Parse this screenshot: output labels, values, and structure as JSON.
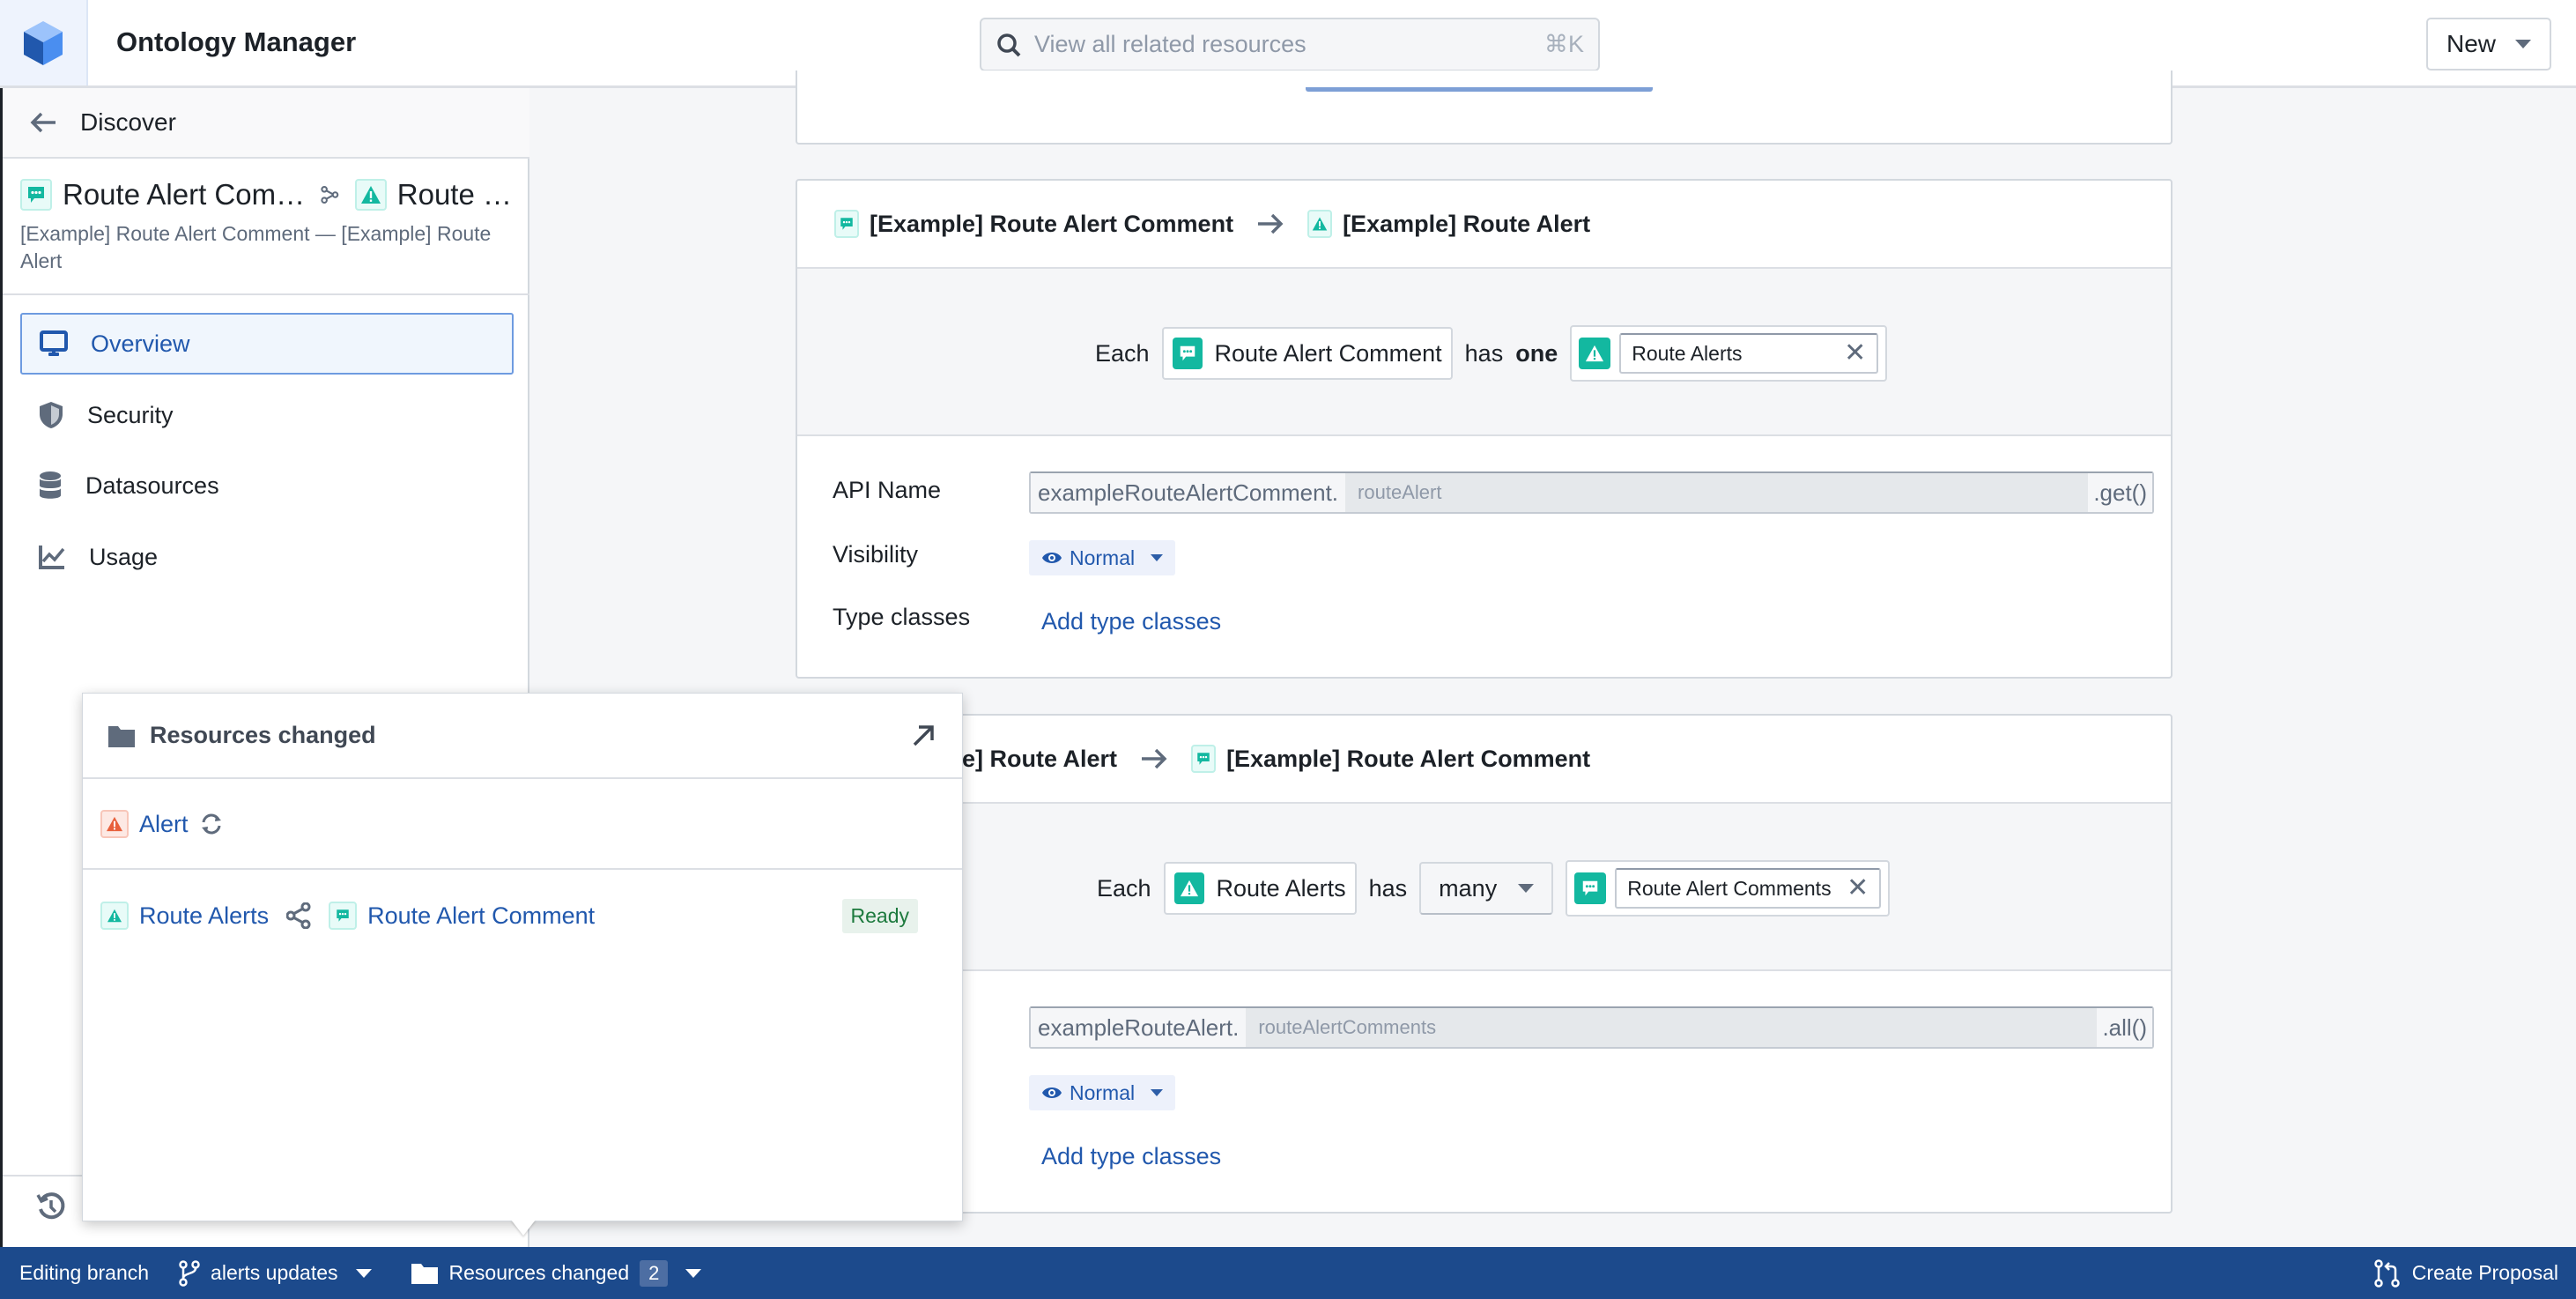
{
  "header": {
    "app_title": "Ontology Manager",
    "search_placeholder": "View all related resources",
    "search_shortcut": "⌘K",
    "new_button": "New"
  },
  "sidebar": {
    "back_label": "Discover",
    "link_title_left": "Route Alert Com…",
    "link_title_right": "Route …",
    "link_subtitle": "[Example] Route Alert Comment — [Example] Route Alert",
    "nav_items": [
      {
        "label": "Overview",
        "icon": "monitor-icon",
        "active": true
      },
      {
        "label": "Security",
        "icon": "shield-icon",
        "active": false
      },
      {
        "label": "Datasources",
        "icon": "database-icon",
        "active": false
      },
      {
        "label": "Usage",
        "icon": "chart-line-icon",
        "active": false
      }
    ],
    "history_icon": "history-icon"
  },
  "cards": [
    {
      "source": "[Example] Route Alert Comment",
      "target": "[Example] Route Alert",
      "each_label": "Each",
      "source_chip": "Route Alert Comment",
      "has_label": "has",
      "cardinality": "one",
      "target_value": "Route Alerts",
      "api_name_label": "API Name",
      "api_prefix": "exampleRouteAlertComment.",
      "api_placeholder": "routeAlert",
      "api_suffix": ".get()",
      "visibility_label": "Visibility",
      "visibility_value": "Normal",
      "type_classes_label": "Type classes",
      "add_type_classes": "Add type classes"
    },
    {
      "source": "[Example] Route Alert",
      "target": "[Example] Route Alert Comment",
      "each_label": "Each",
      "source_chip": "Route Alerts",
      "has_label": "has",
      "cardinality": "many",
      "target_value": "Route Alert Comments",
      "api_prefix": "exampleRouteAlert.",
      "api_placeholder": "routeAlertComments",
      "api_suffix": ".all()",
      "visibility_value": "Normal",
      "add_type_classes": "Add type classes"
    }
  ],
  "popover": {
    "title": "Resources changed",
    "items": [
      {
        "label": "Alert",
        "icon": "alert-icon",
        "status_icon": "sync-icon"
      },
      {
        "left": "Route Alerts",
        "right": "Route Alert Comment",
        "status": "Ready"
      }
    ]
  },
  "bottom_bar": {
    "editing_label": "Editing branch",
    "branch_name": "alerts updates",
    "resources_label": "Resources changed",
    "resources_count": "2",
    "create_proposal": "Create Proposal"
  },
  "colors": {
    "accent": "#2158ad",
    "bottom_bar": "#1c4a8c",
    "object_teal": "#13b8a0",
    "alert_red": "#e8603c",
    "ready_green": "#1d7a3e"
  }
}
